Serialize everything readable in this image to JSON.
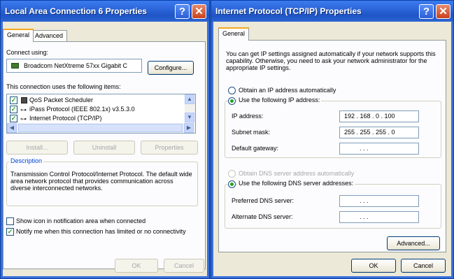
{
  "left_window": {
    "title": "Local Area Connection 6 Properties",
    "help_glyph": "?",
    "close_glyph": "✕",
    "tabs": [
      "General",
      "Advanced"
    ],
    "connect_using_label": "Connect using:",
    "adapter_name": "Broadcom NetXtreme 57xx Gigabit C",
    "configure_button": "Configure...",
    "items_label": "This connection uses the following items:",
    "items": [
      {
        "label": "QoS Packet Scheduler",
        "checked": true
      },
      {
        "label": "iPass Protocol (IEEE 802.1x) v3.5.3.0",
        "checked": true
      },
      {
        "label": "Internet Protocol (TCP/IP)",
        "checked": true
      }
    ],
    "install_button": "Install...",
    "uninstall_button": "Uninstall",
    "properties_button": "Properties",
    "description_title": "Description",
    "description_text": "Transmission Control Protocol/Internet Protocol. The default wide area network protocol that provides communication across diverse interconnected networks.",
    "show_icon_label": "Show icon in notification area when connected",
    "notify_label": "Notify me when this connection has limited or no connectivity",
    "ok_button": "OK",
    "cancel_button": "Cancel"
  },
  "right_window": {
    "title": "Internet Protocol (TCP/IP) Properties",
    "help_glyph": "?",
    "close_glyph": "✕",
    "tab": "General",
    "intro_text": "You can get IP settings assigned automatically if your network supports this capability. Otherwise, you need to ask your network administrator for the appropriate IP settings.",
    "obtain_ip_auto": "Obtain an IP address automatically",
    "use_following_ip": "Use the following IP address:",
    "ip_address_label": "IP address:",
    "ip_address_value": "192 . 168 .  0  . 100",
    "subnet_label": "Subnet mask:",
    "subnet_value": "255 . 255 . 255 .  0",
    "gateway_label": "Default gateway:",
    "gateway_value": ".       .       .",
    "obtain_dns_auto": "Obtain DNS server address automatically",
    "use_following_dns": "Use the following DNS server addresses:",
    "preferred_dns_label": "Preferred DNS server:",
    "preferred_dns_value": ".       .       .",
    "alternate_dns_label": "Alternate DNS server:",
    "alternate_dns_value": ".       .       .",
    "advanced_button": "Advanced...",
    "ok_button": "OK",
    "cancel_button": "Cancel"
  },
  "colors": {
    "titlebar": "#2a63d6",
    "dialog_face": "#ece9d8",
    "tab_accent": "#f4a71e",
    "check_green": "#21a121"
  }
}
